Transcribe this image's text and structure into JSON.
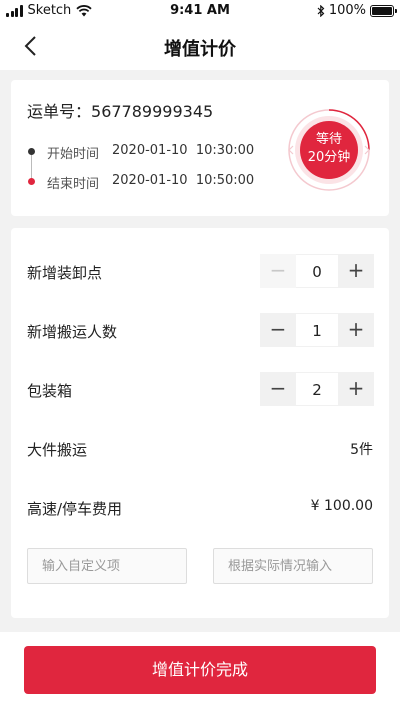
{
  "status_bar": {
    "carrier": "Sketch",
    "time": "9:41 AM",
    "battery": "100%"
  },
  "nav": {
    "title": "增值计价",
    "back_icon": "chevron-left-icon"
  },
  "order": {
    "order_no_label": "运单号：",
    "order_no": "567789999345",
    "start_label": "开始时间",
    "start_time": "2020-01-10  10:30:00",
    "end_label": "结束时间",
    "end_time": "2020-01-10  10:50:00",
    "wait_line1": "等待",
    "wait_line2": "20分钟"
  },
  "pricing": {
    "items": [
      {
        "label": "新增装卸点",
        "value": "0",
        "minus_disabled": true
      },
      {
        "label": "新增搬运人数",
        "value": "1",
        "minus_disabled": false
      },
      {
        "label": "包装箱",
        "value": "2",
        "minus_disabled": false
      }
    ],
    "stepper_minus": "−",
    "stepper_plus": "+",
    "large_item_label": "大件搬运",
    "large_item_value": "5件",
    "fee_label": "高速/停车费用",
    "fee_value": "¥ 100.00",
    "custom_placeholder": "输入自定义项",
    "amount_placeholder": "根据实际情况输入"
  },
  "submit_label": "增值计价完成",
  "colors": {
    "accent": "#e0263e",
    "background": "#f2f2f2"
  }
}
